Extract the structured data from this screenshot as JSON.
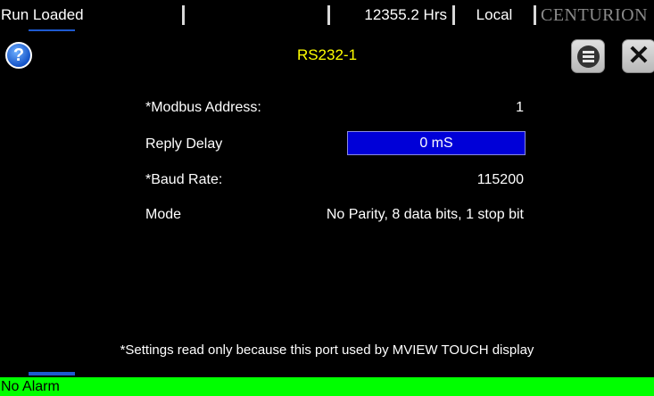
{
  "statusbar": {
    "run_state": "Run Loaded",
    "blank_segment": "",
    "hours": "12355.2 Hrs",
    "mode": "Local",
    "brand": "CENTURION"
  },
  "header": {
    "help_icon": "help-circle-icon",
    "help_glyph": "?",
    "title": "RS232-1",
    "menu_icon": "menu-icon",
    "close_icon": "close-icon",
    "close_glyph": "✕"
  },
  "settings": {
    "modbus_address": {
      "label": "*Modbus Address:",
      "value": "1"
    },
    "reply_delay": {
      "label": "Reply Delay",
      "value": "0 mS"
    },
    "baud_rate": {
      "label": "*Baud Rate:",
      "value": "115200"
    },
    "mode": {
      "label": "Mode",
      "value": "No Parity, 8 data bits, 1 stop bit"
    }
  },
  "note": "*Settings read only because this port used by MVIEW TOUCH display",
  "alarm": "No Alarm",
  "colors": {
    "title": "#ffff00",
    "field_bg": "#0000d8",
    "alarm_bg": "#00ff00",
    "accent_tab": "#1e5ad0"
  }
}
